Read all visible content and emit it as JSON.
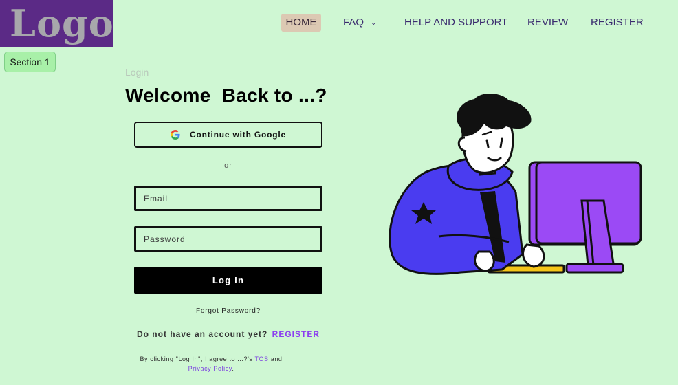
{
  "header": {
    "logo_text": "Logo",
    "nav": {
      "home": "HOME",
      "faq": "FAQ",
      "help": "HELP AND SUPPORT",
      "review": "REVIEW",
      "register": "REGISTER"
    }
  },
  "section_badge": "Section 1",
  "login": {
    "breadcrumb": "Login",
    "title": "Welcome  Back to ...?",
    "google_label": "Continue with Google",
    "or_label": "or",
    "email_placeholder": "Email",
    "password_placeholder": "Password",
    "login_label": "Log In",
    "forgot_label": "Forgot Password?",
    "no_account_text": "Do not have an account yet?",
    "register_link": "REGISTER",
    "tos_prefix": "By clicking \"Log In\", I agree to ...?'s",
    "tos_link": "TOS",
    "tos_and": "and",
    "privacy_link": "Privacy Policy",
    "tos_suffix": "."
  },
  "icons": {
    "google": "google-icon",
    "faq_dropdown": "chevron-down-icon"
  },
  "colors": {
    "background": "#cff7d3",
    "logo_bg": "#5b2a86",
    "accent": "#8b3df0",
    "nav_active": "#dcc9b3",
    "button": "#000000"
  }
}
